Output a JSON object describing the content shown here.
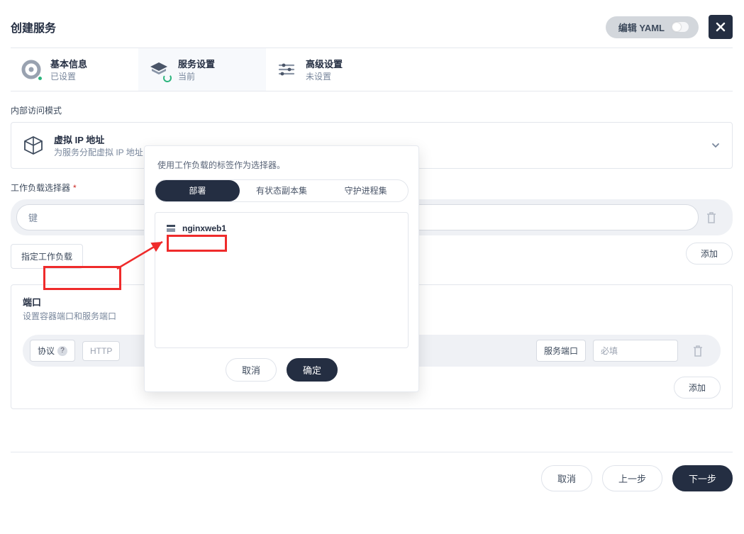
{
  "header": {
    "title": "创建服务",
    "yaml_label": "编辑 YAML"
  },
  "steps": {
    "basic": {
      "title": "基本信息",
      "sub": "已设置"
    },
    "service": {
      "title": "服务设置",
      "sub": "当前"
    },
    "advanced": {
      "title": "高级设置",
      "sub": "未设置"
    }
  },
  "access": {
    "section": "内部访问模式",
    "title": "虚拟 IP 地址",
    "sub": "为服务分配虚拟 IP 地址"
  },
  "selector": {
    "section": "工作负载选择器",
    "key_placeholder": "键",
    "specify_button": "指定工作负载",
    "add_button": "添加"
  },
  "ports": {
    "title": "端口",
    "sub": "设置容器端口和服务端口",
    "protocol_label": "协议",
    "protocol_value": "HTTP",
    "svc_port_label": "服务端口",
    "svc_port_placeholder": "必填",
    "add_button": "添加"
  },
  "popover": {
    "desc": "使用工作负载的标签作为选择器。",
    "tabs": {
      "deploy": "部署",
      "sts": "有状态副本集",
      "ds": "守护进程集"
    },
    "items": [
      "nginxweb1"
    ],
    "cancel": "取消",
    "ok": "确定"
  },
  "footer": {
    "cancel": "取消",
    "prev": "上一步",
    "next": "下一步"
  }
}
